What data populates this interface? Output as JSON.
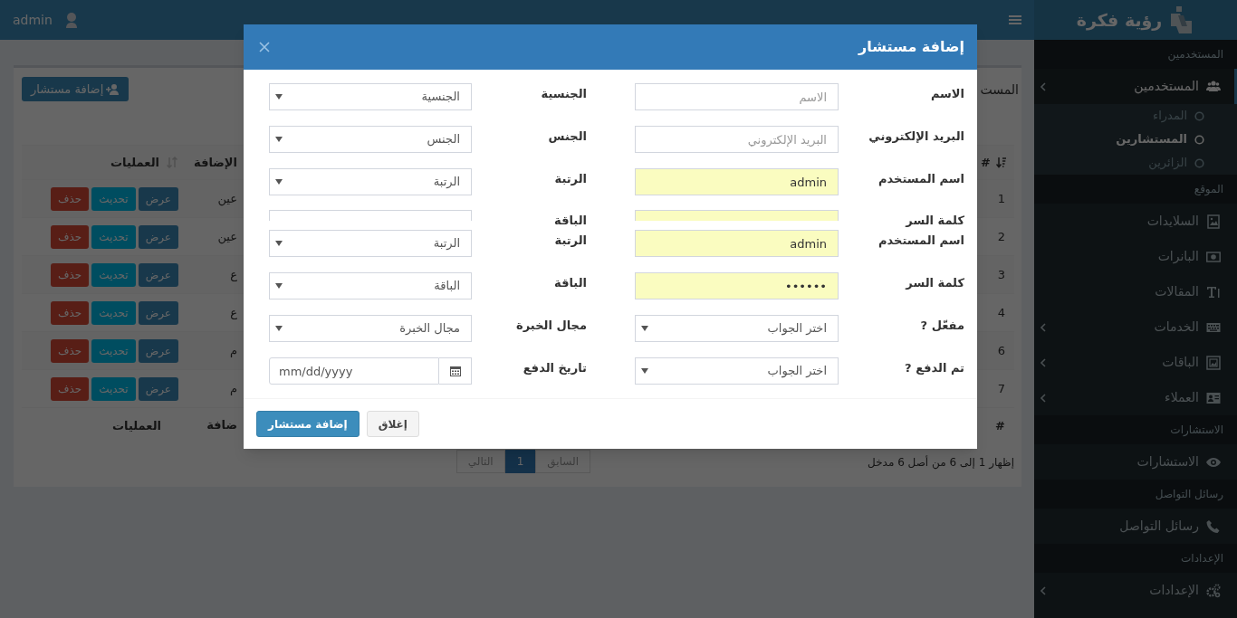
{
  "header": {
    "user": "admin"
  },
  "sidebar": {
    "logo": "رؤية فكرة",
    "sections": [
      {
        "header": "المستخدمين",
        "items": [
          {
            "label": "المستخدمين",
            "selected": true,
            "expandable": true,
            "children": [
              {
                "label": "المدراء",
                "selected": false
              },
              {
                "label": "المستشارين",
                "selected": true
              },
              {
                "label": "الزائرين",
                "selected": false
              }
            ]
          }
        ]
      },
      {
        "header": "الموقع",
        "items": [
          {
            "label": "السلايدات",
            "selected": false,
            "expandable": false
          },
          {
            "label": "البانرات",
            "selected": false,
            "expandable": false
          },
          {
            "label": "المقالات",
            "selected": false,
            "expandable": false
          },
          {
            "label": "الخدمات",
            "selected": false,
            "expandable": true
          },
          {
            "label": "الباقات",
            "selected": false,
            "expandable": true
          },
          {
            "label": "العملاء",
            "selected": false,
            "expandable": true
          }
        ]
      },
      {
        "header": "الاستشارات",
        "items": [
          {
            "label": "الاستشارات",
            "selected": false,
            "expandable": false
          }
        ]
      },
      {
        "header": "رسائل التواصل",
        "items": [
          {
            "label": "رسائل التواصل",
            "selected": false,
            "expandable": false
          }
        ]
      },
      {
        "header": "الإعدادات",
        "items": [
          {
            "label": "الإعدادات",
            "selected": false,
            "expandable": true
          }
        ]
      }
    ]
  },
  "content": {
    "title": "المست",
    "add_button": "إضافة مستشار",
    "table": {
      "columns": {
        "number": "#",
        "date": "الإضافة",
        "actions": "العمليات"
      },
      "rows": [
        {
          "number": "1",
          "date": "عين",
          "actions": [
            {
              "label": "عرض",
              "kind": "view"
            },
            {
              "label": "تحديث",
              "kind": "update"
            },
            {
              "label": "حذف",
              "kind": "delete"
            }
          ]
        },
        {
          "number": "2",
          "date": "عين",
          "actions": [
            {
              "label": "عرض",
              "kind": "view"
            },
            {
              "label": "تحديث",
              "kind": "update"
            },
            {
              "label": "حذف",
              "kind": "delete"
            }
          ]
        },
        {
          "number": "3",
          "date": "ع",
          "actions": [
            {
              "label": "عرض",
              "kind": "view"
            },
            {
              "label": "تحديث",
              "kind": "update"
            },
            {
              "label": "حذف",
              "kind": "delete"
            }
          ]
        },
        {
          "number": "4",
          "date": "ع",
          "actions": [
            {
              "label": "عرض",
              "kind": "view"
            },
            {
              "label": "تحديث",
              "kind": "update"
            },
            {
              "label": "حذف",
              "kind": "delete"
            }
          ]
        },
        {
          "number": "6",
          "date": "م",
          "actions": [
            {
              "label": "عرض",
              "kind": "view"
            },
            {
              "label": "تحديث",
              "kind": "update"
            },
            {
              "label": "حذف",
              "kind": "delete"
            }
          ]
        },
        {
          "number": "7",
          "date": "م",
          "actions": [
            {
              "label": "عرض",
              "kind": "view"
            },
            {
              "label": "تحديث",
              "kind": "update"
            },
            {
              "label": "حذف",
              "kind": "delete"
            }
          ]
        }
      ],
      "footer": {
        "number": "#",
        "date": "ضافة",
        "actions": "العمليات"
      }
    },
    "info": "إظهار 1 إلى 6 من أصل 6 مدخل",
    "pagination": [
      {
        "label": "السابق",
        "selected": false,
        "disabled": true
      },
      {
        "label": "1",
        "selected": true,
        "disabled": false
      },
      {
        "label": "التالي",
        "selected": false,
        "disabled": true
      }
    ]
  },
  "modal": {
    "title": "إضافة مستشار",
    "rows": [
      {
        "clipped": false,
        "fields": [
          {
            "label": "الاسم",
            "kind": "text",
            "placeholder": "الاسم",
            "autofill": false
          },
          {
            "label": "الجنسية",
            "kind": "select",
            "value": "الجنسية",
            "autofill": false
          }
        ]
      },
      {
        "clipped": false,
        "fields": [
          {
            "label": "البريد الإلكتروني",
            "kind": "text",
            "placeholder": "البريد الإلكتروني",
            "autofill": false
          },
          {
            "label": "الجنس",
            "kind": "select",
            "value": "الجنس",
            "autofill": false
          }
        ]
      },
      {
        "clipped": false,
        "fields": [
          {
            "label": "اسم المستخدم",
            "kind": "text",
            "value": "admin",
            "autofill": true
          },
          {
            "label": "الرتبة",
            "kind": "select",
            "value": "الرتبة",
            "autofill": false
          }
        ]
      },
      {
        "clipped": true,
        "fields": [
          {
            "label": "كلمة السر",
            "kind": "password",
            "autofill": true
          },
          {
            "label": "الباقة",
            "kind": "select",
            "autofill": false
          }
        ]
      },
      {
        "clipped": false,
        "fields": [
          {
            "label": "اسم المستخدم",
            "kind": "text",
            "value": "admin",
            "autofill": true
          },
          {
            "label": "الرتبة",
            "kind": "select",
            "value": "الرتبة",
            "autofill": false
          }
        ]
      },
      {
        "clipped": false,
        "fields": [
          {
            "label": "كلمة السر",
            "kind": "password",
            "value": "••••••",
            "autofill": true
          },
          {
            "label": "الباقة",
            "kind": "select",
            "value": "الباقة",
            "autofill": false
          }
        ]
      },
      {
        "clipped": false,
        "fields": [
          {
            "label": "مفعّل ?",
            "kind": "select",
            "value": "اختر الجواب",
            "autofill": false
          },
          {
            "label": "مجال الخبرة",
            "kind": "select",
            "value": "مجال الخبرة",
            "autofill": false
          }
        ]
      },
      {
        "clipped": false,
        "fields": [
          {
            "label": "تم الدفع ?",
            "kind": "select",
            "value": "اختر الجواب",
            "autofill": false
          },
          {
            "label": "تاريخ الدفع",
            "kind": "date",
            "placeholder": "mm/dd/yyyy",
            "autofill": false
          }
        ]
      }
    ],
    "buttons": [
      {
        "label": "إغلاق",
        "kind": "default"
      },
      {
        "label": "إضافة مستشار",
        "kind": "primary"
      }
    ]
  }
}
